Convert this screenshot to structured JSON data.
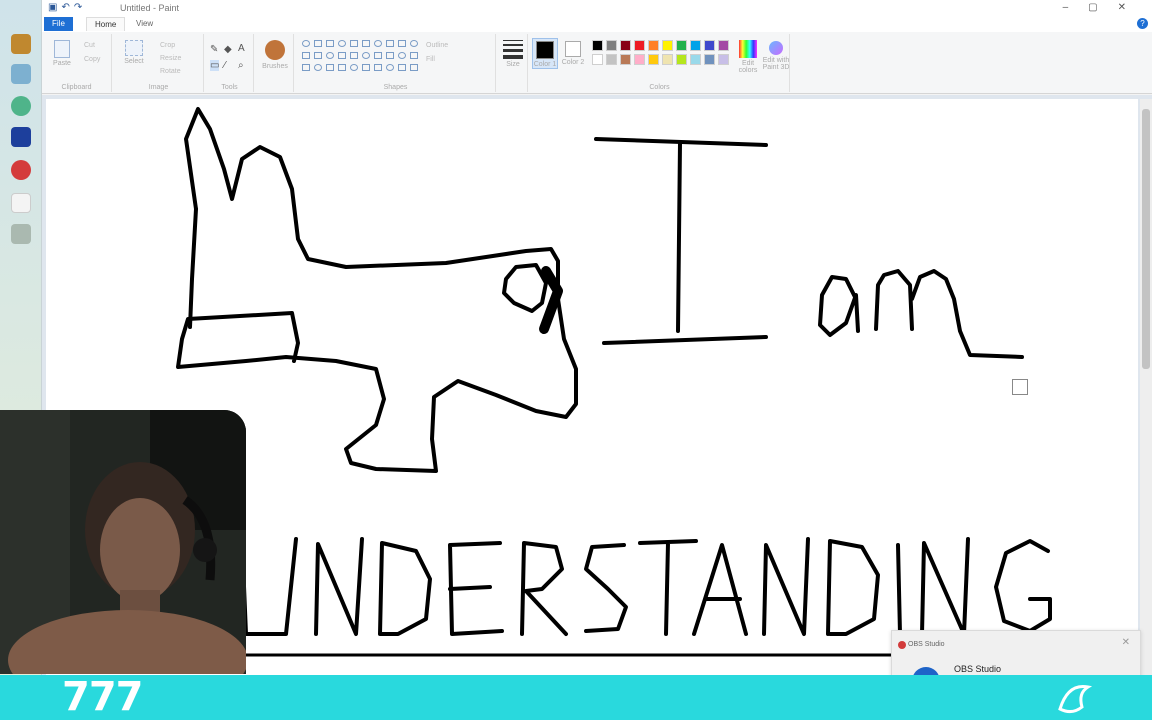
{
  "window": {
    "title": "Untitled - Paint"
  },
  "menu": {
    "tabs": [
      "File",
      "Home",
      "View"
    ]
  },
  "ribbon": {
    "groups": [
      "Clipboard",
      "Image",
      "Tools",
      "Shapes",
      "Colors"
    ],
    "clipboard": {
      "paste": "Paste",
      "cut": "Cut",
      "copy": "Copy"
    },
    "image": {
      "select": "Select",
      "crop": "Crop",
      "resize": "Resize",
      "rotate": "Rotate"
    },
    "brushes": "Brushes",
    "shapes": {
      "outline": "Outline",
      "fill": "Fill"
    },
    "size": "Size",
    "color1": "Color 1",
    "color2": "Color 2",
    "edit_colors": "Edit colors",
    "paint3d": "Edit with Paint 3D",
    "palette": [
      "#000000",
      "#7f7f7f",
      "#880015",
      "#ed1c24",
      "#ff7f27",
      "#fff200",
      "#22b14c",
      "#00a2e8",
      "#3f48cc",
      "#a349a4",
      "#ffffff",
      "#c3c3c3",
      "#b97a57",
      "#ffaec9",
      "#ffc90e",
      "#efe4b0",
      "#b5e61d",
      "#99d9ea",
      "#7092be",
      "#c8bfe7"
    ]
  },
  "drawing": {
    "line1": "I am",
    "line2": "UNDERSTANDING"
  },
  "notification": {
    "app": "OBS Studio",
    "title": "OBS Studio"
  },
  "banner": {
    "text": "777",
    "color": "#29d9dd"
  }
}
